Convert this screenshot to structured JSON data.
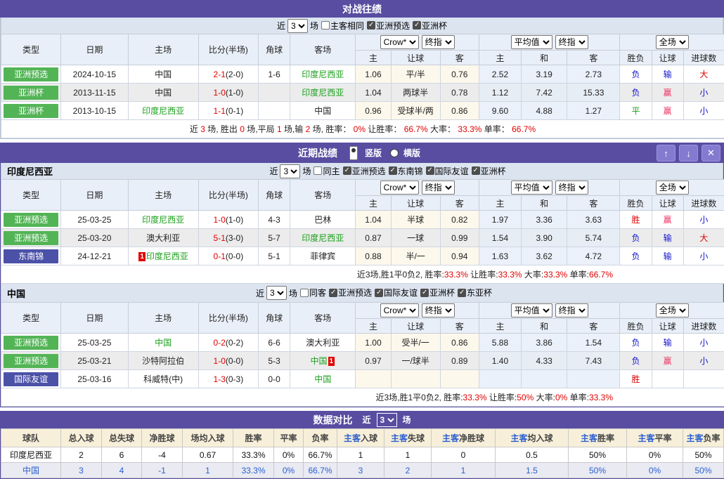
{
  "colors": {
    "purple": "#584DA1",
    "purple_button": "#847BD0",
    "green_badge": "#53B456",
    "blue_badge": "#4C51A8",
    "team_green": "#1CA01C",
    "win_red": "#E00000",
    "lose_blue": "#1414CC",
    "odds_win_pink": "#EE3465",
    "link_blue": "#2B5FD0",
    "header_bg": "#E9EFF8",
    "filter_bg": "#DCE4F0",
    "compare_header_bg": "#F7EFD9"
  },
  "shared": {
    "near_label": "近",
    "games_label": "场",
    "games_value": "3",
    "columns": [
      "类型",
      "日期",
      "主场",
      "比分(半场)",
      "角球",
      "客场"
    ],
    "sub_columns": [
      "主",
      "让球",
      "客",
      "主",
      "和",
      "客",
      "胜负",
      "让球",
      "进球数"
    ],
    "selects": {
      "bookmaker": "Crow*",
      "bookmaker_stage": "终指",
      "average": "平均值",
      "average_stage": "终指",
      "scope": "全场"
    }
  },
  "h2h": {
    "title": "对战往绩",
    "checkboxes": [
      {
        "label": "主客相同",
        "on": false
      },
      {
        "label": "亚洲预选",
        "on": true
      },
      {
        "label": "亚洲杯",
        "on": true
      }
    ],
    "rows": [
      {
        "type": {
          "t": "亚洲预选",
          "badge": "green"
        },
        "date": "2024-10-15",
        "home": {
          "t": "中国"
        },
        "score": [
          "2-1",
          "(2-0)"
        ],
        "corner": "1-6",
        "away": {
          "t": "印度尼西亚",
          "green": true
        },
        "odds": [
          "1.06",
          "平/半",
          "0.76"
        ],
        "avg": [
          "2.52",
          "3.19",
          "2.73"
        ],
        "res": [
          {
            "t": "负",
            "c": "b"
          },
          {
            "t": "输",
            "c": "b"
          },
          {
            "t": "大",
            "c": "r"
          }
        ]
      },
      {
        "type": {
          "t": "亚洲杯",
          "badge": "green"
        },
        "date": "2013-11-15",
        "home": {
          "t": "中国"
        },
        "score": [
          "1-0",
          "(1-0)"
        ],
        "corner": "",
        "away": {
          "t": "印度尼西亚",
          "green": true
        },
        "odds": [
          "1.04",
          "两球半",
          "0.78"
        ],
        "avg": [
          "1.12",
          "7.42",
          "15.33"
        ],
        "res": [
          {
            "t": "负",
            "c": "b"
          },
          {
            "t": "赢",
            "c": "p"
          },
          {
            "t": "小",
            "c": "b"
          }
        ]
      },
      {
        "type": {
          "t": "亚洲杯",
          "badge": "green"
        },
        "date": "2013-10-15",
        "home": {
          "t": "印度尼西亚",
          "green": true
        },
        "score": [
          "1-1",
          "(0-1)"
        ],
        "corner": "",
        "away": {
          "t": "中国"
        },
        "odds": [
          "0.96",
          "受球半/两",
          "0.86"
        ],
        "avg": [
          "9.60",
          "4.88",
          "1.27"
        ],
        "res": [
          {
            "t": "平",
            "c": "g"
          },
          {
            "t": "赢",
            "c": "p"
          },
          {
            "t": "小",
            "c": "b"
          }
        ]
      }
    ],
    "summary": [
      {
        "t": "近 "
      },
      {
        "t": "3",
        "r": 1
      },
      {
        "t": " 场, 胜出 "
      },
      {
        "t": "0",
        "r": 1
      },
      {
        "t": " 场,平局 "
      },
      {
        "t": "1",
        "r": 1
      },
      {
        "t": " 场,输 "
      },
      {
        "t": "2",
        "r": 1
      },
      {
        "t": " 场, 胜率： "
      },
      {
        "t": "0%",
        "r": 1
      },
      {
        "t": " 让胜率： "
      },
      {
        "t": "66.7%",
        "r": 1
      },
      {
        "t": " 大率： "
      },
      {
        "t": "33.3%",
        "r": 1
      },
      {
        "t": " 单率： "
      },
      {
        "t": "66.7%",
        "r": 1
      }
    ]
  },
  "recent": {
    "title": "近期战绩",
    "view_options": [
      {
        "label": "竖版",
        "selected": true
      },
      {
        "label": "横版",
        "selected": false
      }
    ],
    "buttons": {
      "up": "↑",
      "down": "↓",
      "close": "✕"
    },
    "indonesia": {
      "team": "印度尼西亚",
      "checkboxes": [
        {
          "label": "同主",
          "on": false
        },
        {
          "label": "亚洲预选",
          "on": true
        },
        {
          "label": "东南锦",
          "on": true
        },
        {
          "label": "国际友谊",
          "on": true
        },
        {
          "label": "亚洲杯",
          "on": true
        }
      ],
      "rows": [
        {
          "type": {
            "t": "亚洲预选",
            "badge": "green"
          },
          "date": "25-03-25",
          "home": {
            "t": "印度尼西亚",
            "green": true
          },
          "score": [
            "1-0",
            "(1-0)"
          ],
          "corner": "4-3",
          "away": {
            "t": "巴林"
          },
          "odds": [
            "1.04",
            "半球",
            "0.82"
          ],
          "avg": [
            "1.97",
            "3.36",
            "3.63"
          ],
          "res": [
            {
              "t": "胜",
              "c": "r"
            },
            {
              "t": "赢",
              "c": "p"
            },
            {
              "t": "小",
              "c": "b"
            }
          ]
        },
        {
          "type": {
            "t": "亚洲预选",
            "badge": "green"
          },
          "date": "25-03-20",
          "home": {
            "t": "澳大利亚"
          },
          "score": [
            "5-1",
            "(3-0)"
          ],
          "corner": "5-7",
          "away": {
            "t": "印度尼西亚",
            "green": true
          },
          "odds": [
            "0.87",
            "一球",
            "0.99"
          ],
          "avg": [
            "1.54",
            "3.90",
            "5.74"
          ],
          "res": [
            {
              "t": "负",
              "c": "b"
            },
            {
              "t": "输",
              "c": "b"
            },
            {
              "t": "大",
              "c": "r"
            }
          ]
        },
        {
          "type": {
            "t": "东南锦",
            "badge": "blue"
          },
          "date": "24-12-21",
          "home": {
            "t": "印度尼西亚",
            "green": true,
            "card_before": "1"
          },
          "score": [
            "0-1",
            "(0-0)"
          ],
          "corner": "5-1",
          "away": {
            "t": "菲律宾"
          },
          "odds": [
            "0.88",
            "半/一",
            "0.94"
          ],
          "avg": [
            "1.63",
            "3.62",
            "4.72"
          ],
          "res": [
            {
              "t": "负",
              "c": "b"
            },
            {
              "t": "输",
              "c": "b"
            },
            {
              "t": "小",
              "c": "b"
            }
          ]
        }
      ],
      "summary": [
        {
          "t": "近3场,胜1平0负2, 胜率:"
        },
        {
          "t": "33.3%",
          "r": 1
        },
        {
          "t": " 让胜率:"
        },
        {
          "t": "33.3%",
          "r": 1
        },
        {
          "t": " 大率:"
        },
        {
          "t": "33.3%",
          "r": 1
        },
        {
          "t": " 单率:"
        },
        {
          "t": "66.7%",
          "r": 1
        }
      ]
    },
    "china": {
      "team": "中国",
      "checkboxes": [
        {
          "label": "同客",
          "on": false
        },
        {
          "label": "亚洲预选",
          "on": true
        },
        {
          "label": "国际友谊",
          "on": true
        },
        {
          "label": "亚洲杯",
          "on": true
        },
        {
          "label": "东亚杯",
          "on": true
        }
      ],
      "rows": [
        {
          "type": {
            "t": "亚洲预选",
            "badge": "green"
          },
          "date": "25-03-25",
          "home": {
            "t": "中国",
            "green": true
          },
          "score": [
            "0-2",
            "(0-2)"
          ],
          "corner": "6-6",
          "away": {
            "t": "澳大利亚"
          },
          "odds": [
            "1.00",
            "受半/一",
            "0.86"
          ],
          "avg": [
            "5.88",
            "3.86",
            "1.54"
          ],
          "res": [
            {
              "t": "负",
              "c": "b"
            },
            {
              "t": "输",
              "c": "b"
            },
            {
              "t": "小",
              "c": "b"
            }
          ]
        },
        {
          "type": {
            "t": "亚洲预选",
            "badge": "green"
          },
          "date": "25-03-21",
          "home": {
            "t": "沙特阿拉伯"
          },
          "score": [
            "1-0",
            "(0-0)"
          ],
          "corner": "5-3",
          "away": {
            "t": "中国",
            "green": true,
            "card_after": "1"
          },
          "odds": [
            "0.97",
            "一/球半",
            "0.89"
          ],
          "avg": [
            "1.40",
            "4.33",
            "7.43"
          ],
          "res": [
            {
              "t": "负",
              "c": "b"
            },
            {
              "t": "赢",
              "c": "p"
            },
            {
              "t": "小",
              "c": "b"
            }
          ]
        },
        {
          "type": {
            "t": "国际友谊",
            "badge": "blue"
          },
          "date": "25-03-16",
          "home": {
            "t": "科威特(中)"
          },
          "score": [
            "1-3",
            "(0-3)"
          ],
          "corner": "0-0",
          "away": {
            "t": "中国",
            "green": true
          },
          "odds": [
            "",
            "",
            ""
          ],
          "avg": [
            "",
            "",
            ""
          ],
          "res": [
            {
              "t": "胜",
              "c": "r"
            },
            {
              "t": "",
              "c": "n"
            },
            {
              "t": "",
              "c": "n"
            }
          ]
        }
      ],
      "summary": [
        {
          "t": "近3场,胜1平0负2, 胜率:"
        },
        {
          "t": "33.3%",
          "r": 1
        },
        {
          "t": " 让胜率:"
        },
        {
          "t": "50%",
          "r": 1
        },
        {
          "t": " 大率:"
        },
        {
          "t": "0%",
          "r": 1
        },
        {
          "t": " 单率:"
        },
        {
          "t": "33.3%",
          "r": 1
        }
      ]
    }
  },
  "compare": {
    "title": "数据对比",
    "near_label": "近",
    "games_label": "场",
    "games_value": "3",
    "headers": [
      {
        "t": "球队"
      },
      {
        "t": "总入球"
      },
      {
        "t": "总失球"
      },
      {
        "t": "净胜球"
      },
      {
        "t": "场均入球"
      },
      {
        "t": "胜率"
      },
      {
        "t": "平率"
      },
      {
        "t": "负率"
      },
      {
        "a": "主客",
        "t": "入球"
      },
      {
        "a": "主客",
        "t": "失球"
      },
      {
        "a": "主客",
        "t": "净胜球"
      },
      {
        "a": "主客",
        "t": "均入球"
      },
      {
        "a": "主客",
        "t": "胜率"
      },
      {
        "a": "主客",
        "t": "平率"
      },
      {
        "a": "主客",
        "t": "负率"
      }
    ],
    "rows": [
      {
        "team": "印度尼西亚",
        "highlight": false,
        "values": [
          "2",
          "6",
          "-4",
          "0.67",
          "33.3%",
          "0%",
          "66.7%",
          "1",
          "1",
          "0",
          "0.5",
          "50%",
          "0%",
          "50%"
        ]
      },
      {
        "team": "中国",
        "highlight": true,
        "values": [
          "3",
          "4",
          "-1",
          "1",
          "33.3%",
          "0%",
          "66.7%",
          "3",
          "2",
          "1",
          "1.5",
          "50%",
          "0%",
          "50%"
        ]
      }
    ]
  }
}
